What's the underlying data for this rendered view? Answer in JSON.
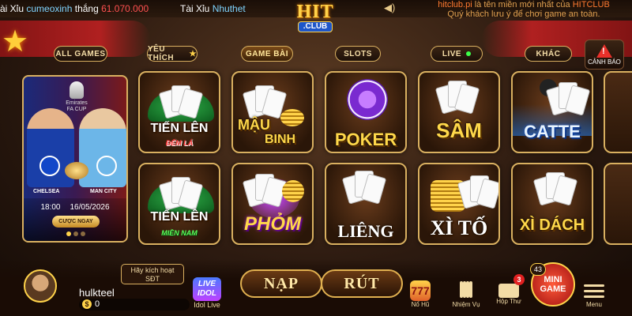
{
  "ticker": {
    "item1_prefix": "ài Xỉu",
    "item1_user": "cumeoxinh",
    "item1_wins": "thắng",
    "item1_amount": "61.070.000",
    "item2_prefix": "Tài Xỉu",
    "item2_user": "Nhuthet"
  },
  "notice": {
    "line1_prefix": "hitclub.pi",
    "line1_rest": "là tên miền mới nhất của",
    "line1_brand": "HITCLUB",
    "line2": "Quý khách lưu ý để chơi game an toàn."
  },
  "logo": {
    "main": "HIT",
    "sub": ".CLUB"
  },
  "tabs": [
    {
      "label": "ALL GAMES"
    },
    {
      "label": "YÊU THÍCH"
    },
    {
      "label": "GAME BÀI"
    },
    {
      "label": "SLOTS"
    },
    {
      "label": "LIVE"
    },
    {
      "label": "KHÁC"
    }
  ],
  "warning": {
    "label": "CẢNH BÁO",
    "symbol": "!"
  },
  "match": {
    "cup_line1": "Emirates",
    "cup_line2": "FA CUP",
    "team1": "CHELSEA",
    "team2": "MAN CITY",
    "time": "18:00",
    "date": "16/05/2026",
    "bet_label": "CƯỢC NGAY"
  },
  "games": [
    {
      "title": "TIẾN LÊN",
      "sub": "ĐẾM LÁ"
    },
    {
      "title": "MẬU",
      "sub": "BINH"
    },
    {
      "title": "POKER"
    },
    {
      "title": "SÂM"
    },
    {
      "title": "CATTE"
    },
    {
      "title": "TIẾN LÊN",
      "sub": "MIỀN NAM"
    },
    {
      "title": "PHỎM"
    },
    {
      "title": "LIÊNG"
    },
    {
      "title": "XÌ TỐ"
    },
    {
      "title": "XÌ DÁCH"
    }
  ],
  "user": {
    "activate_line1": "Hãy kích hoạt",
    "activate_line2": "SĐT",
    "name": "hulkteel",
    "currency": "$",
    "balance": "0"
  },
  "bottom_nav": {
    "idol_badge_line1": "LIVE",
    "idol_badge_line2": "IDOL",
    "idol_label": "Idol Live",
    "deposit": "NẠP",
    "withdraw": "RÚT",
    "jackpot_label": "Nổ Hũ",
    "jackpot_icon": "777",
    "tasks_label": "Nhiệm Vụ",
    "mail_label": "Hộp Thư",
    "mail_count": "3",
    "mini_line1": "MINI",
    "mini_line2": "GAME",
    "mini_count": "43",
    "menu_label": "Menu"
  },
  "colors": {
    "accent_gold": "#ffd34a",
    "border_gold": "#d9b060",
    "winner_amount": "#ff5050",
    "user_name": "#7fd4ff",
    "live_dot": "#3cff4a"
  }
}
